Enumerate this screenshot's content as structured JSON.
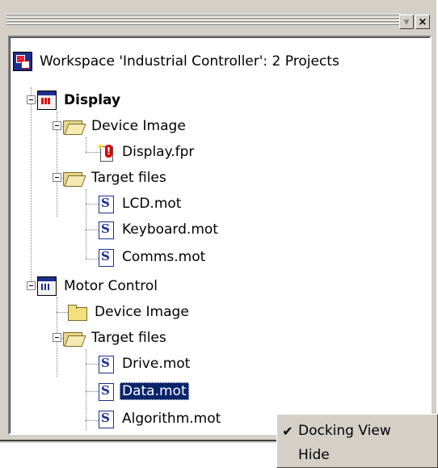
{
  "window": {
    "minimize_glyph": "▾",
    "close_glyph": "×"
  },
  "tree": {
    "workspace": {
      "label": "Workspace 'Industrial Controller': 2 Projects",
      "icon": "workspace-icon"
    },
    "projects": [
      {
        "label": "Display",
        "bold": true,
        "folders": [
          {
            "label": "Device Image",
            "expanded": true,
            "files": [
              {
                "label": "Display.fpr",
                "icon": "fpr-file-icon"
              }
            ]
          },
          {
            "label": "Target files",
            "expanded": true,
            "files": [
              {
                "label": "LCD.mot",
                "icon": "mot-file-icon"
              },
              {
                "label": "Keyboard.mot",
                "icon": "mot-file-icon"
              },
              {
                "label": "Comms.mot",
                "icon": "mot-file-icon"
              }
            ]
          }
        ]
      },
      {
        "label": "Motor Control",
        "bold": false,
        "folders": [
          {
            "label": "Device Image",
            "expanded": false,
            "files": []
          },
          {
            "label": "Target files",
            "expanded": true,
            "files": [
              {
                "label": "Drive.mot",
                "icon": "mot-file-icon"
              },
              {
                "label": "Data.mot",
                "icon": "mot-file-icon",
                "selected": true
              },
              {
                "label": "Algorithm.mot",
                "icon": "mot-file-icon"
              }
            ]
          }
        ]
      }
    ],
    "mot_glyph": "S"
  },
  "context_menu": {
    "items": [
      {
        "label": "Docking View",
        "checked": true,
        "check_glyph": "✔"
      },
      {
        "label": "Hide",
        "checked": false,
        "check_glyph": ""
      }
    ]
  }
}
